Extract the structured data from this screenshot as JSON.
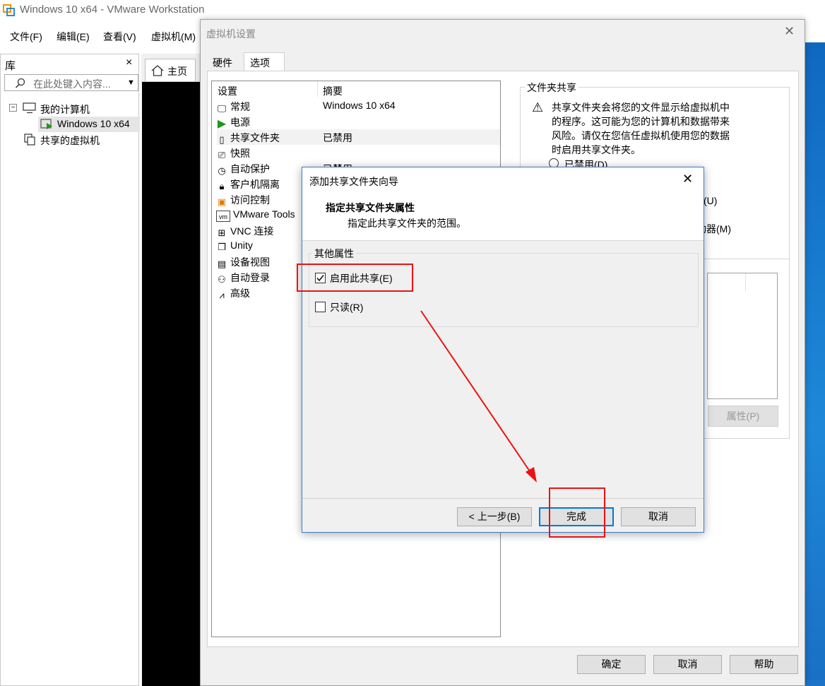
{
  "window": {
    "title": "Windows 10 x64 - VMware Workstation",
    "menus": [
      "文件(F)",
      "编辑(E)",
      "查看(V)",
      "虚拟机(M)"
    ]
  },
  "library": {
    "title": "库",
    "close": "×",
    "search_placeholder": "在此处键入内容...",
    "tree": {
      "my_computer": "我的计算机",
      "vm": "Windows 10 x64",
      "shared": "共享的虚拟机"
    }
  },
  "home_tab": {
    "label": "主页"
  },
  "settings": {
    "title": "虚拟机设置",
    "tabs": [
      "硬件",
      "选项"
    ],
    "columns": {
      "setting": "设置",
      "summary": "摘要"
    },
    "items": [
      {
        "label": "常规",
        "summary": "Windows 10 x64",
        "icon": "monitor-icon"
      },
      {
        "label": "电源",
        "summary": "",
        "icon": "play-icon"
      },
      {
        "label": "共享文件夹",
        "summary": "已禁用",
        "icon": "folder-share-icon"
      },
      {
        "label": "快照",
        "summary": "",
        "icon": "snapshot-icon"
      },
      {
        "label": "自动保护",
        "summary": "已禁用",
        "icon": "clock-icon"
      },
      {
        "label": "客户机隔离",
        "summary": "",
        "icon": "lock-icon"
      },
      {
        "label": "访问控制",
        "summary": "",
        "icon": "access-control-icon"
      },
      {
        "label": "VMware Tools",
        "summary": "",
        "icon": "vm-icon"
      },
      {
        "label": "VNC 连接",
        "summary": "",
        "icon": "vnc-icon"
      },
      {
        "label": "Unity",
        "summary": "",
        "icon": "unity-icon"
      },
      {
        "label": "设备视图",
        "summary": "",
        "icon": "device-view-icon"
      },
      {
        "label": "自动登录",
        "summary": "",
        "icon": "autologin-icon"
      },
      {
        "label": "高级",
        "summary": "",
        "icon": "advanced-icon"
      }
    ],
    "folder_sharing": {
      "legend": "文件夹共享",
      "warning": [
        "共享文件夹会将您的文件显示给虚拟机中",
        "的程序。这可能为您的计算机和数据带来",
        "风险。请仅在您信任虚拟机使用您的数据",
        "时启用共享文件夹。"
      ],
      "disabled_option": "已禁用(D)",
      "partial_u": "(U)",
      "partial_m": "驱动器(M)",
      "properties_button": "属性(P)"
    },
    "buttons": {
      "ok": "确定",
      "cancel": "取消",
      "help": "帮助"
    }
  },
  "wizard": {
    "title": "添加共享文件夹向导",
    "heading": "指定共享文件夹属性",
    "subheading": "指定此共享文件夹的范围。",
    "group_label": "其他属性",
    "enable_share": {
      "label": "启用此共享(E)",
      "checked": true
    },
    "read_only": {
      "label": "只读(R)",
      "checked": false
    },
    "buttons": {
      "back": "< 上一步(B)",
      "finish": "完成",
      "cancel": "取消"
    }
  }
}
